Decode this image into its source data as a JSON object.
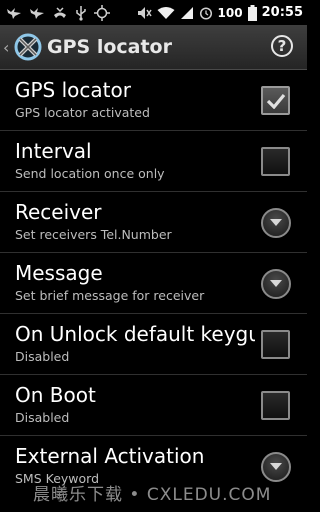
{
  "status_bar": {
    "battery": "100",
    "time": "20:55"
  },
  "title_bar": {
    "title": "GPS locator",
    "help_label": "?"
  },
  "preferences": [
    {
      "title": "GPS locator",
      "summary": "GPS locator activated",
      "control": "checkbox",
      "checked": true
    },
    {
      "title": "Interval",
      "summary": "Send location once only",
      "control": "checkbox",
      "checked": false
    },
    {
      "title": "Receiver",
      "summary": "Set receivers Tel.Number",
      "control": "dropdown"
    },
    {
      "title": "Message",
      "summary": "Set brief message for receiver",
      "control": "dropdown"
    },
    {
      "title": "On Unlock default keygu",
      "summary": "Disabled",
      "control": "checkbox",
      "checked": false
    },
    {
      "title": "On Boot",
      "summary": "Disabled",
      "control": "checkbox",
      "checked": false
    },
    {
      "title": "External Activation",
      "summary": "SMS Keyword",
      "control": "dropdown"
    }
  ],
  "watermark": "晨曦乐下载 • CXLEDU.COM"
}
